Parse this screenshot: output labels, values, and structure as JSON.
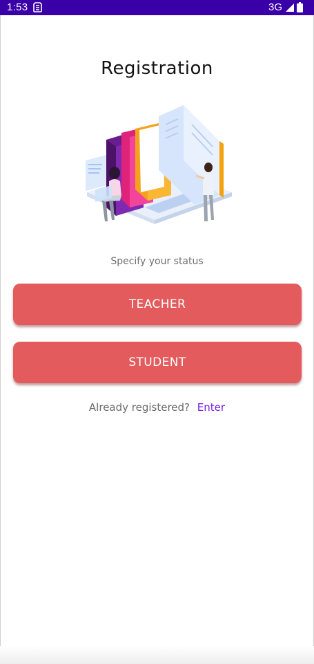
{
  "status_bar": {
    "time": "1:53",
    "network": "3G",
    "background": "#3a00a8",
    "icons": [
      "sim-card-icon",
      "signal-icon",
      "battery-icon"
    ]
  },
  "screen": {
    "title": "Registration",
    "illustration": "books-and-readers-illustration",
    "subtitle": "Specify your status"
  },
  "buttons": {
    "teacher_label": "TEACHER",
    "student_label": "STUDENT",
    "color": "#e35b5c"
  },
  "footer": {
    "question": "Already registered?",
    "link_label": "Enter",
    "link_color": "#7a1ee8"
  }
}
